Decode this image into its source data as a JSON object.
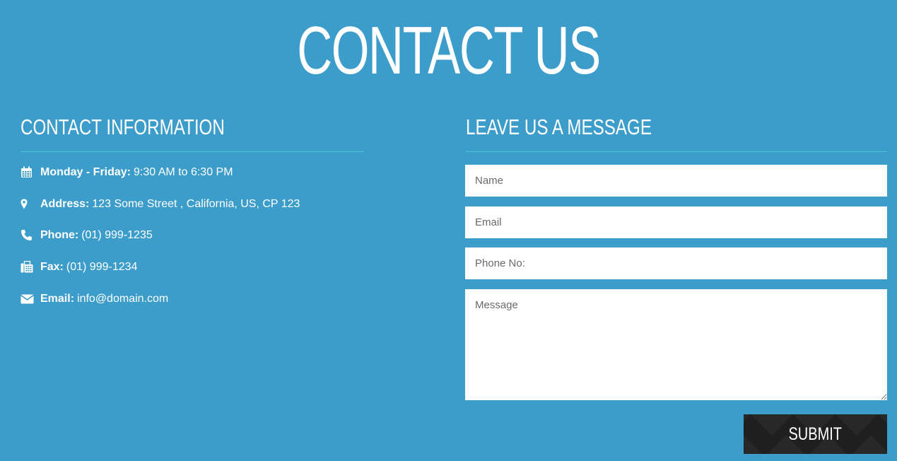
{
  "page": {
    "title": "CONTACT US",
    "background_color": "#3c9dcb"
  },
  "contact_info": {
    "heading": "CONTACT INFORMATION",
    "items": [
      {
        "icon": "calendar-icon",
        "label": "Monday - Friday:",
        "value": "9:30 AM to 6:30 PM"
      },
      {
        "icon": "map-marker-icon",
        "label": "Address:",
        "value": "123 Some Street , California, US, CP 123"
      },
      {
        "icon": "phone-icon",
        "label": "Phone:",
        "value": "(01) 999-1235"
      },
      {
        "icon": "fax-icon",
        "label": "Fax:",
        "value": "(01) 999-1234"
      },
      {
        "icon": "envelope-icon",
        "label": "Email:",
        "value": "info@domain.com"
      }
    ]
  },
  "message_form": {
    "heading": "LEAVE US A MESSAGE",
    "name_placeholder": "Name",
    "email_placeholder": "Email",
    "phone_placeholder": "Phone No:",
    "message_placeholder": "Message",
    "submit_label": "SUBMIT",
    "submit_color": "#1f1f1f"
  }
}
